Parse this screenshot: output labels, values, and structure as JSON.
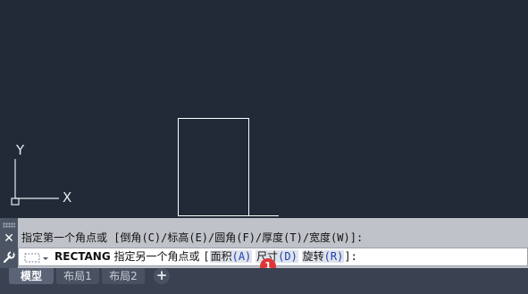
{
  "ucs": {
    "y_label": "Y",
    "x_label": "X"
  },
  "command_history": "指定第一个角点或 [倒角(C)/标高(E)/圆角(F)/厚度(T)/宽度(W)]:",
  "command_line": {
    "command": "RECTANG",
    "prompt": "指定另一个角点或",
    "open_bracket": "[",
    "options": [
      {
        "label": "面积",
        "key": "(A)"
      },
      {
        "label": "尺寸",
        "key": "(D)"
      },
      {
        "label": "旋转",
        "key": "(R)"
      }
    ],
    "close": "]:"
  },
  "marker_number": "1",
  "tabs": [
    {
      "label": "模型",
      "active": true
    },
    {
      "label": "布局1",
      "active": false
    },
    {
      "label": "布局2",
      "active": false
    }
  ],
  "add_tab_symbol": "+",
  "colors": {
    "canvas_bg": "#222a38",
    "command_bg": "#bfc3c9",
    "option_key": "#1a3fb5",
    "marker": "#e03535"
  }
}
